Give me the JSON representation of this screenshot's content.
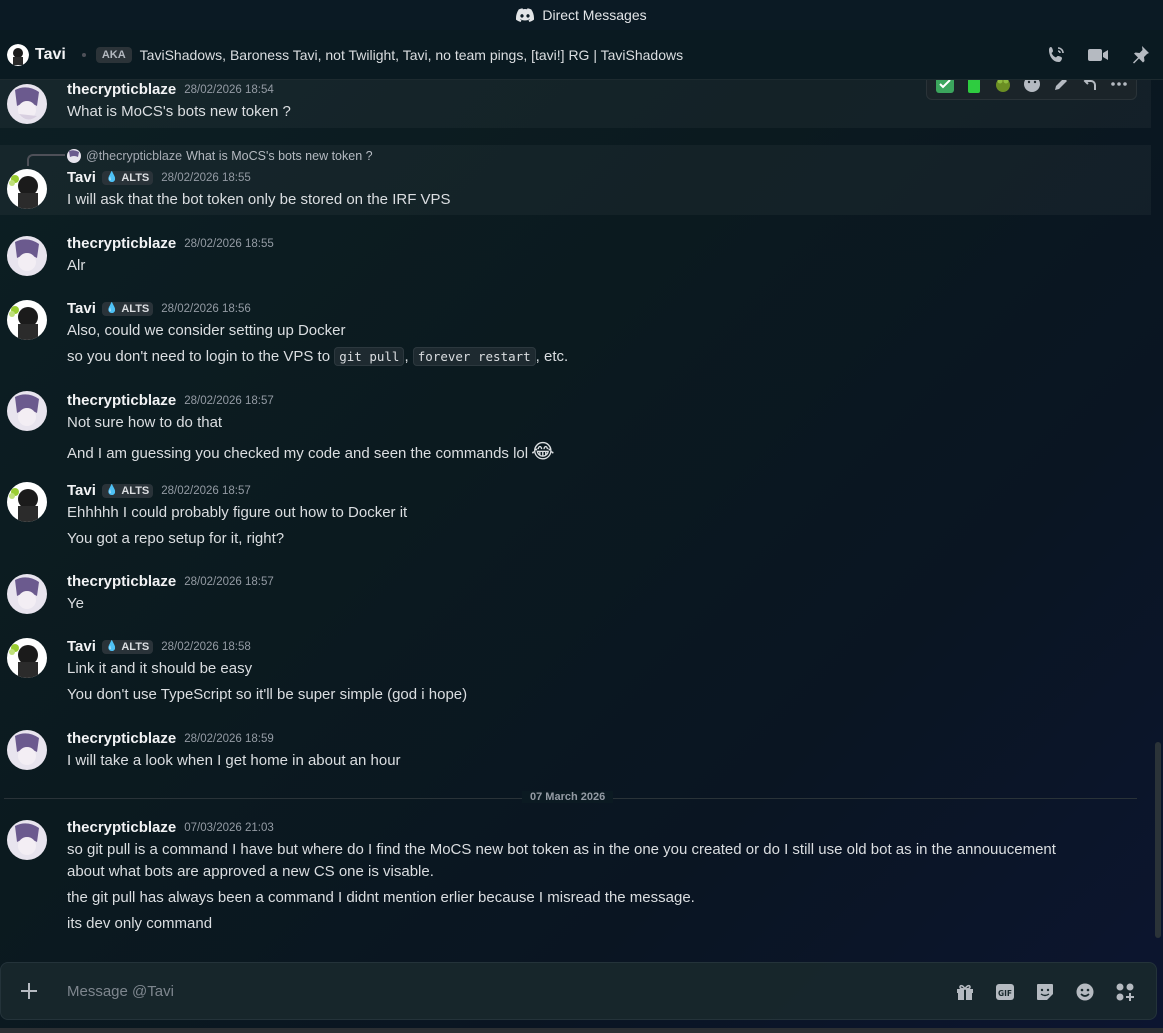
{
  "window": {
    "title": "Direct Messages"
  },
  "header": {
    "name": "Tavi",
    "aka_label": "AKA",
    "aka_list": "TaviShadows, Baroness Tavi, not Twilight, Tavi, no team pings, [tavi!] RG | TaviShadows"
  },
  "messages": [
    {
      "author": "thecrypticblaze",
      "time": "28/02/2026 18:54",
      "lines": [
        "What is MoCS's bots new token ?"
      ]
    },
    {
      "reply_to": "@thecrypticblaze",
      "reply_text": "What is MoCS's bots new token ?",
      "author": "Tavi",
      "tag": "ALTS",
      "time": "28/02/2026 18:55",
      "lines": [
        "I will ask that the bot token only be stored on the IRF VPS"
      ]
    },
    {
      "author": "thecrypticblaze",
      "time": "28/02/2026 18:55",
      "lines": [
        "Alr"
      ]
    },
    {
      "author": "Tavi",
      "tag": "ALTS",
      "time": "28/02/2026 18:56",
      "lines": [
        "Also, could we consider setting up Docker"
      ],
      "line2_prefix": "so you don't need to login to the VPS to ",
      "code1": "git pull",
      "sep": ", ",
      "code2": "forever restart",
      "line2_suffix": ", etc."
    },
    {
      "author": "thecrypticblaze",
      "time": "28/02/2026 18:57",
      "lines": [
        "Not sure how to do that",
        "And I am guessing you checked my code and seen the commands lol"
      ],
      "emoji": "😂"
    },
    {
      "author": "Tavi",
      "tag": "ALTS",
      "time": "28/02/2026 18:57",
      "lines": [
        "Ehhhhh I could probably figure out how to Docker it",
        "You got a repo setup for it, right?"
      ]
    },
    {
      "author": "thecrypticblaze",
      "time": "28/02/2026 18:57",
      "lines": [
        "Ye"
      ]
    },
    {
      "author": "Tavi",
      "tag": "ALTS",
      "time": "28/02/2026 18:58",
      "lines": [
        "Link it and it should be easy",
        "You don't use TypeScript so it'll be super simple (god i hope)"
      ]
    },
    {
      "author": "thecrypticblaze",
      "time": "28/02/2026 18:59",
      "lines": [
        "I will take a look when I get home in about an hour"
      ]
    },
    {
      "author": "thecrypticblaze",
      "time": "07/03/2026 21:03",
      "lines": [
        "so git pull is a command I have but where do I find the MoCS new bot token as in the one you created or do I still use old bot as in the annouucement",
        "about what bots are approved a new CS one is visable.",
        "the git pull has always been a command I didnt mention erlier because I misread the message.",
        "its dev only command"
      ]
    }
  ],
  "date_divider": "07 March 2026",
  "composer": {
    "placeholder": "Message @Tavi"
  },
  "colors": {
    "accent": "#5865f2",
    "alts_drop": "#8fc7ff",
    "green_check": "#3ba55d"
  }
}
